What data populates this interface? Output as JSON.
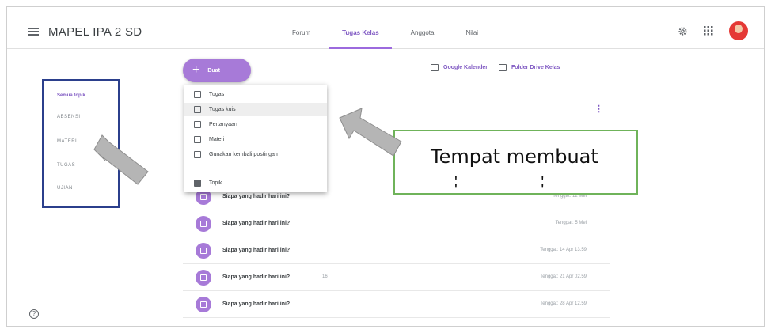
{
  "header": {
    "title": "MAPEL IPA 2 SD",
    "tabs": [
      {
        "label": "Forum"
      },
      {
        "label": "Tugas Kelas"
      },
      {
        "label": "Anggota"
      },
      {
        "label": "Nilai"
      }
    ],
    "active_tab": "Tugas Kelas"
  },
  "create_button": {
    "label": "Buat"
  },
  "links": {
    "calendar": "Google Kalender",
    "drive": "Folder Drive Kelas"
  },
  "topics": [
    "Semua topik",
    "ABSENSI",
    "MATERI",
    "TUGAS",
    "UJIAN"
  ],
  "create_menu": [
    {
      "label": "Tugas",
      "icon": "assignment-icon"
    },
    {
      "label": "Tugas kuis",
      "icon": "quiz-icon"
    },
    {
      "label": "Pertanyaan",
      "icon": "question-icon"
    },
    {
      "label": "Materi",
      "icon": "material-icon"
    },
    {
      "label": "Gunakan kembali postingan",
      "icon": "reuse-icon"
    },
    {
      "label": "Topik",
      "icon": "topic-icon"
    }
  ],
  "posts": [
    {
      "title": "Siapa yang hadir hari ini?",
      "due": "Tenggat: 12 Mei",
      "attach": ""
    },
    {
      "title": "Siapa yang hadir hari ini?",
      "due": "Tenggat: 5 Mei",
      "attach": ""
    },
    {
      "title": "Siapa yang hadir hari ini?",
      "due": "Tenggat: 14 Apr 13.59",
      "attach": ""
    },
    {
      "title": "Siapa yang hadir hari ini?",
      "due": "Tenggat: 21 Apr 02.59",
      "attach": "16"
    },
    {
      "title": "Siapa yang hadir hari ini?",
      "due": "Tenggat: 28 Apr 12.59",
      "attach": ""
    }
  ],
  "annotation": {
    "text": "Tempat membuat"
  },
  "colors": {
    "accent": "#9c6ade",
    "callout_border": "#6fb35a",
    "topic_box_border": "#2b3f8c"
  }
}
